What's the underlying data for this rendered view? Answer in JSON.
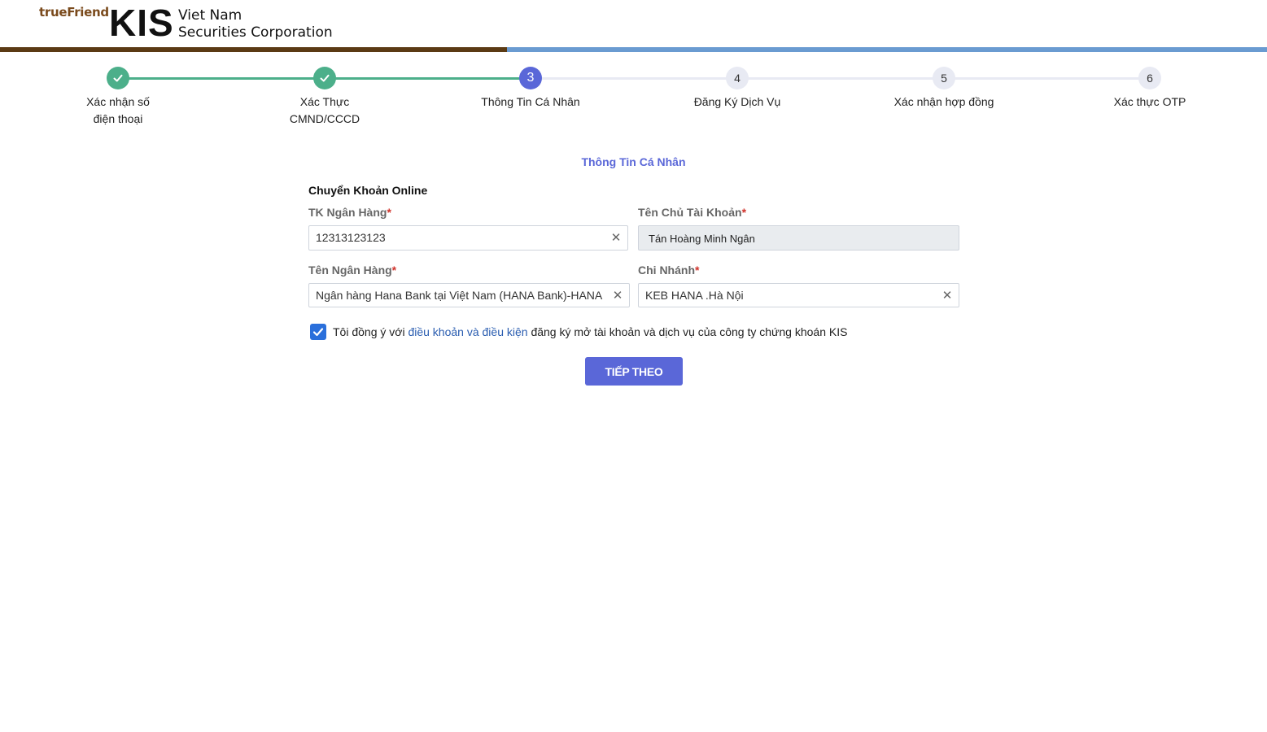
{
  "header": {
    "brand_small": "trueFriend",
    "brand_main": "KIS",
    "brand_line1": "Viet Nam",
    "brand_line2": "Securities Corporation",
    "progress_fraction": 0.4,
    "colors": {
      "progress_done": "#5b3a14",
      "progress_rest": "#6a9bd1"
    }
  },
  "stepper": {
    "current_step": 3,
    "steps": [
      {
        "label": "Xác nhận số điện thoại",
        "number": "1",
        "state": "done"
      },
      {
        "label": "Xác Thực CMND/CCCD",
        "number": "2",
        "state": "done"
      },
      {
        "label": "Thông Tin Cá Nhân",
        "number": "3",
        "state": "active"
      },
      {
        "label": "Đăng Ký Dịch Vụ",
        "number": "4",
        "state": "todo"
      },
      {
        "label": "Xác nhận hợp đồng",
        "number": "5",
        "state": "todo"
      },
      {
        "label": "Xác thực OTP",
        "number": "6",
        "state": "todo"
      }
    ],
    "colors": {
      "done": "#4caf8a",
      "active": "#5a67d8",
      "todo": "#e8eaf3"
    }
  },
  "section_title": "Thông Tin Cá Nhân",
  "form": {
    "group_title": "Chuyển Khoản Online",
    "bank_account": {
      "label": "TK Ngân Hàng",
      "required_mark": "*",
      "value": "12313123123"
    },
    "account_holder": {
      "label": "Tên Chủ Tài Khoản",
      "required_mark": "*",
      "value": "Tán Hoàng Minh Ngân"
    },
    "bank_name": {
      "label": "Tên Ngân Hàng",
      "required_mark": "*",
      "value": "Ngân hàng Hana Bank tại Việt Nam (HANA Bank)-HANA BANK"
    },
    "branch": {
      "label": "Chi Nhánh",
      "required_mark": "*",
      "value": "KEB HANA .Hà Nội"
    },
    "agree": {
      "checked": true,
      "text_before": "Tôi đồng ý với ",
      "link_text": "điều khoản và điều kiện",
      "text_after": " đăng ký mở tài khoản và dịch vụ của công ty chứng khoán KIS"
    },
    "next_button": "TIẾP THEO"
  }
}
